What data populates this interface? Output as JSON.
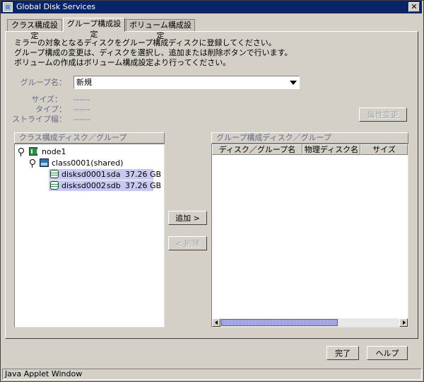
{
  "window": {
    "title": "Global Disk Services"
  },
  "tabs": [
    {
      "label": "クラス構成設定"
    },
    {
      "label": "グループ構成設定"
    },
    {
      "label": "ボリューム構成設定"
    }
  ],
  "description": [
    "ミラーの対象となるディスクをグループ構成ディスクに登録してください。",
    "グループ構成の変更は、ディスクを選択し、追加または削除ボタンで行います。",
    "ボリュームの作成はボリューム構成設定より行ってください。"
  ],
  "form": {
    "group_name_label": "グループ名：",
    "group_name_value": "新規",
    "size_label": "サイズ：",
    "size_value": "------",
    "type_label": "タイプ：",
    "type_value": "------",
    "stripe_label": "ストライプ幅：",
    "stripe_value": "------",
    "attr_button": "属性変更"
  },
  "left_panel": {
    "header": "クラス構成ディスク／グループ",
    "tree": {
      "node": "node1",
      "class": "class0001(shared)",
      "disks": [
        {
          "name": "disksd0001",
          "device": "sda",
          "size": "37.26 GB"
        },
        {
          "name": "disksd0002",
          "device": "sdb",
          "size": "37.26 GB"
        }
      ]
    }
  },
  "middle": {
    "add_button": "追加 >",
    "remove_button": "< 削除"
  },
  "right_panel": {
    "header": "グループ構成ディスク／グループ",
    "columns": [
      "ディスク／グループ名",
      "物理ディスク名",
      "サイズ"
    ]
  },
  "footer": {
    "done_button": "完了",
    "help_button": "ヘルプ"
  },
  "statusbar": {
    "text": "Java Applet Window"
  }
}
